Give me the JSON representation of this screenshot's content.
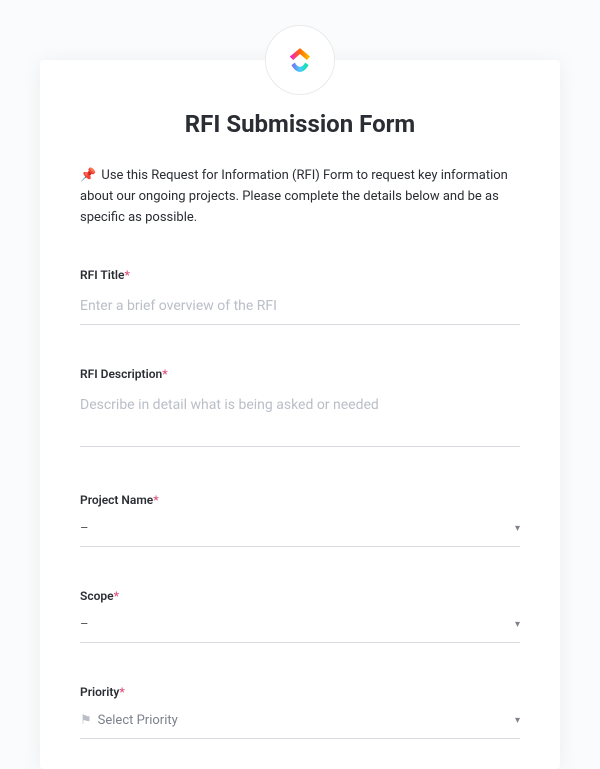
{
  "logo": {
    "name": "clickup-logo"
  },
  "title": "RFI Submission Form",
  "intro": {
    "pin": "📌",
    "text": "Use this Request for Information (RFI) Form to request key information about our ongoing projects. Please complete the details below and be as specific as possible."
  },
  "fields": {
    "rfi_title": {
      "label": "RFI Title",
      "required": "*",
      "placeholder": "Enter a brief overview of the RFI"
    },
    "rfi_description": {
      "label": "RFI Description",
      "required": "*",
      "placeholder": "Describe in detail what is being asked or needed"
    },
    "project_name": {
      "label": "Project Name",
      "required": "*",
      "value": "–",
      "caret": "▾"
    },
    "scope": {
      "label": "Scope",
      "required": "*",
      "value": "–",
      "caret": "▾"
    },
    "priority": {
      "label": "Priority",
      "required": "*",
      "placeholder": "Select Priority",
      "caret": "▾"
    }
  }
}
